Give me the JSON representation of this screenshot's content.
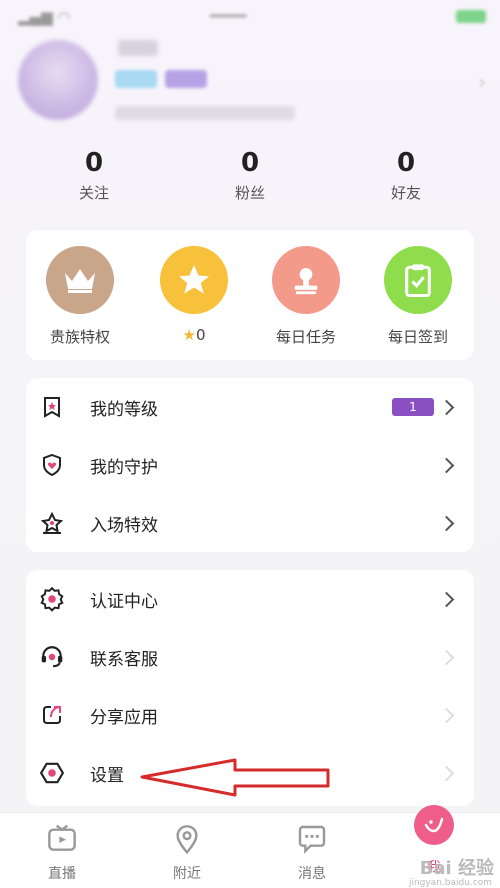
{
  "stats": [
    {
      "value": "0",
      "label": "关注"
    },
    {
      "value": "0",
      "label": "粉丝"
    },
    {
      "value": "0",
      "label": "好友"
    }
  ],
  "quick_actions": [
    {
      "label": "贵族特权",
      "icon": "crown-icon",
      "color": "#c9a58a"
    },
    {
      "label": "0",
      "icon": "star-icon",
      "color": "#f8c13c"
    },
    {
      "label": "每日任务",
      "icon": "stamp-icon",
      "color": "#f39a8a"
    },
    {
      "label": "每日签到",
      "icon": "clipboard-check-icon",
      "color": "#8fdd4c"
    }
  ],
  "menu_group1": [
    {
      "label": "我的等级",
      "badge": "1",
      "icon": "level-bookmark-icon"
    },
    {
      "label": "我的守护",
      "icon": "shield-heart-icon"
    },
    {
      "label": "入场特效",
      "icon": "crown-entrance-icon"
    }
  ],
  "menu_group2": [
    {
      "label": "认证中心",
      "icon": "certification-icon"
    },
    {
      "label": "联系客服",
      "icon": "headset-icon"
    },
    {
      "label": "分享应用",
      "icon": "share-icon"
    },
    {
      "label": "设置",
      "icon": "settings-icon"
    }
  ],
  "tabs": [
    {
      "label": "直播",
      "icon": "tv-icon"
    },
    {
      "label": "附近",
      "icon": "location-icon"
    },
    {
      "label": "消息",
      "icon": "message-icon"
    },
    {
      "label": "我",
      "icon": "me-icon"
    }
  ],
  "watermark": {
    "text": "Bai 经验",
    "sub": "jingyan.baidu.com"
  },
  "colors": {
    "accent": "#e2457a",
    "badge": "#8b4fc4",
    "arrow": "#d62b2b"
  }
}
